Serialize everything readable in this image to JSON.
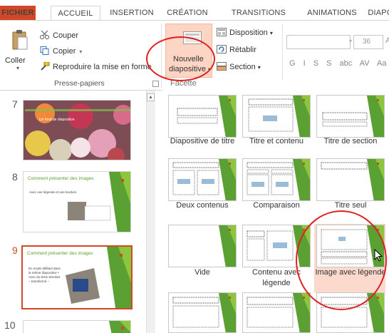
{
  "tabs": {
    "file": "FICHIER",
    "home": "ACCUEIL",
    "insert": "INSERTION",
    "design": "CRÉATION",
    "transitions": "TRANSITIONS",
    "animations": "ANIMATIONS",
    "slideshow": "DIAPO"
  },
  "ribbon": {
    "clipboard": {
      "paste": "Coller",
      "cut": "Couper",
      "copy": "Copier",
      "format_painter": "Reproduire la mise en forme",
      "group_label": "Presse-papiers"
    },
    "slides": {
      "new_slide_line1": "Nouvelle",
      "new_slide_line2": "diapositive",
      "layout": "Disposition",
      "reset": "Rétablir",
      "section": "Section"
    },
    "font": {
      "size": "36",
      "format_buttons": "G  I  S  S  abc  AV  Aa"
    }
  },
  "gallery": {
    "caption": "Facette",
    "layouts": [
      {
        "label": "Diapositive de titre"
      },
      {
        "label": "Titre et contenu"
      },
      {
        "label": "Titre de section"
      },
      {
        "label": "Deux contenus"
      },
      {
        "label": "Comparaison"
      },
      {
        "label": "Titre seul"
      },
      {
        "label": "Vide"
      },
      {
        "label": "Contenu avec légende"
      },
      {
        "label": "Image avec légende"
      }
    ]
  },
  "slides": [
    {
      "number": "7",
      "title": "",
      "subtitle": "Un fond de diapositive"
    },
    {
      "number": "8",
      "title": "Comment présenter des images",
      "bullet": "Avec une légende et une bordure"
    },
    {
      "number": "9",
      "title": "Comment présenter des images",
      "bullet": "En mode défilant dans la même diapositive • Avec du texte Wordart – transformé –"
    },
    {
      "number": "10"
    }
  ],
  "colors": {
    "accent": "#d24726",
    "theme_green": "#5aa032",
    "hover": "#fbd9cc",
    "annotation": "#e02020"
  }
}
